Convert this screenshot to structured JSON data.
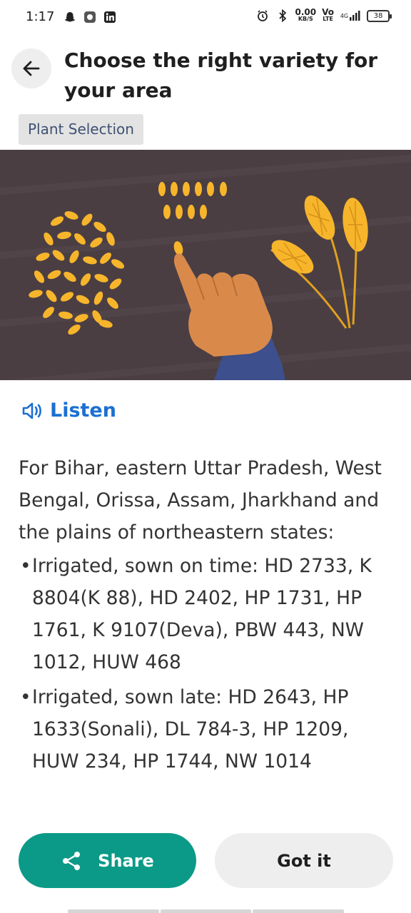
{
  "status_bar": {
    "time": "1:17",
    "net_speed_value": "0.00",
    "net_speed_unit": "KB/S",
    "volte_top": "Vo",
    "volte_bottom": "LTE",
    "network": "4G",
    "battery": "38"
  },
  "header": {
    "back_icon": "arrow-left-icon",
    "title": "Choose the right variety for your area",
    "chip": "Plant Selection"
  },
  "banner": {
    "icons": [
      "wheat-grains",
      "finger-pointing",
      "wheat-stalks"
    ],
    "colors": {
      "background": "#4a3e43",
      "grain": "#f7b52b",
      "skin": "#d98a4b",
      "sleeve": "#3d4f8c"
    }
  },
  "listen": {
    "icon": "speaker-icon",
    "label": "Listen"
  },
  "content": {
    "intro": "For Bihar, eastern Uttar Pradesh, West Bengal, Orissa, Assam, Jharkhand and the plains of northeastern states:",
    "bullets": [
      "Irrigated, sown on time: HD 2733, K 8804(K 88), HD 2402, HP 1731, HP 1761, K 9107(Deva), PBW 443, NW 1012, HUW 468",
      "Irrigated, sown late: HD 2643, HP 1633(Sonali), DL 784-3, HP 1209, HUW 234, HP 1744, NW 1014"
    ],
    "bullet_char": "•"
  },
  "actions": {
    "share_icon": "share-icon",
    "share_label": "Share",
    "got_it_label": "Got it",
    "colors": {
      "share_bg": "#0b9a87",
      "got_it_bg": "#eeeeee",
      "accent": "#1b6fd1"
    }
  }
}
